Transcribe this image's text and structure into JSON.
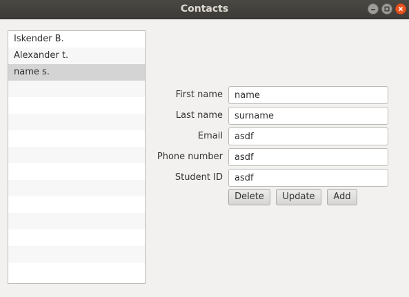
{
  "window": {
    "title": "Contacts",
    "controls": [
      "minimize-icon",
      "maximize-icon",
      "close-icon"
    ],
    "accent_close": "#e95420"
  },
  "contacts_list": {
    "items": [
      "Iskender B.",
      "Alexander t.",
      "name s."
    ],
    "selected_index": 2,
    "empty_rows": 12
  },
  "form": {
    "first_name": {
      "label": "First name",
      "value": "name"
    },
    "last_name": {
      "label": "Last name",
      "value": "surname"
    },
    "email": {
      "label": "Email",
      "value": "asdf"
    },
    "phone": {
      "label": "Phone number",
      "value": "asdf"
    },
    "student_id": {
      "label": "Student ID",
      "value": "asdf"
    }
  },
  "buttons": {
    "delete": "Delete",
    "update": "Update",
    "add": "Add"
  }
}
